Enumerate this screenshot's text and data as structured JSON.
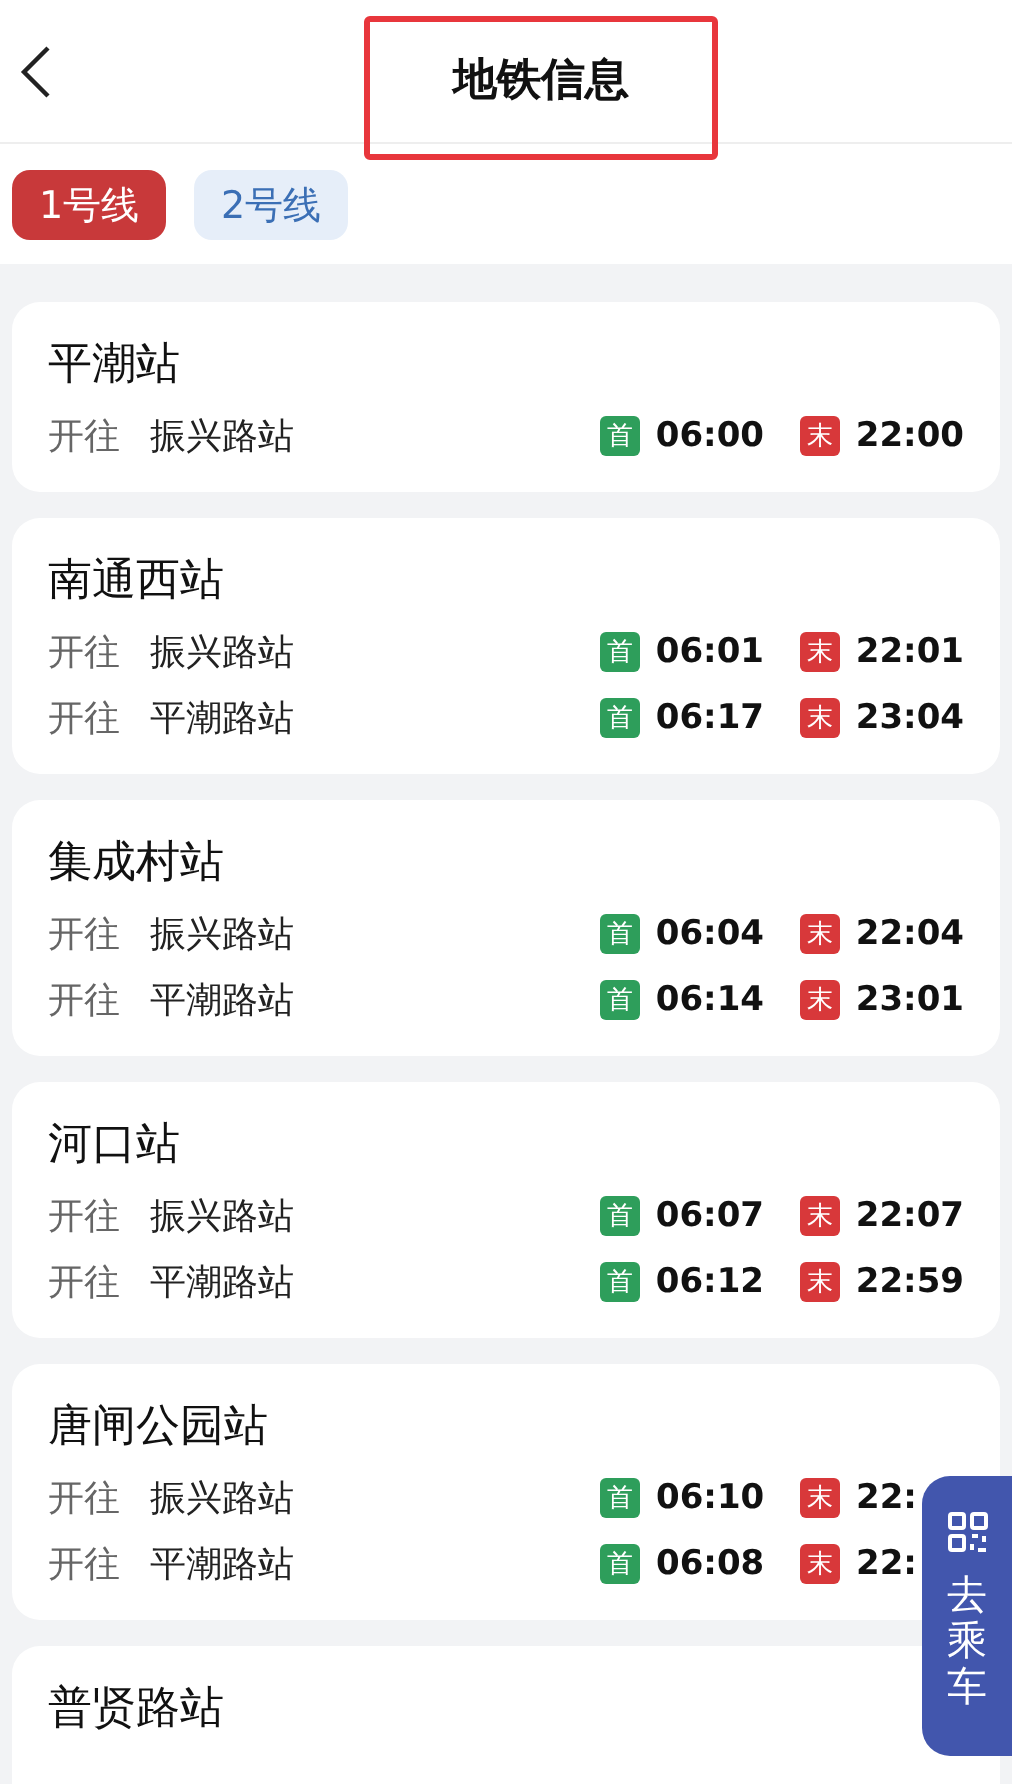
{
  "header": {
    "title": "地铁信息",
    "title_highlighted": true
  },
  "line_tabs": [
    {
      "label": "1号线",
      "selected": true
    },
    {
      "label": "2号线",
      "selected": false
    }
  ],
  "stations": [
    {
      "name": "平潮站",
      "trains": [
        {
          "toward_label": "开往",
          "destination": "振兴路站",
          "first_badge": "首",
          "first_time": "06:00",
          "last_badge": "末",
          "last_time": "22:00"
        }
      ]
    },
    {
      "name": "南通西站",
      "trains": [
        {
          "toward_label": "开往",
          "destination": "振兴路站",
          "first_badge": "首",
          "first_time": "06:01",
          "last_badge": "末",
          "last_time": "22:01"
        },
        {
          "toward_label": "开往",
          "destination": "平潮路站",
          "first_badge": "首",
          "first_time": "06:17",
          "last_badge": "末",
          "last_time": "23:04"
        }
      ]
    },
    {
      "name": "集成村站",
      "trains": [
        {
          "toward_label": "开往",
          "destination": "振兴路站",
          "first_badge": "首",
          "first_time": "06:04",
          "last_badge": "末",
          "last_time": "22:04"
        },
        {
          "toward_label": "开往",
          "destination": "平潮路站",
          "first_badge": "首",
          "first_time": "06:14",
          "last_badge": "末",
          "last_time": "23:01"
        }
      ]
    },
    {
      "name": "河口站",
      "trains": [
        {
          "toward_label": "开往",
          "destination": "振兴路站",
          "first_badge": "首",
          "first_time": "06:07",
          "last_badge": "末",
          "last_time": "22:07"
        },
        {
          "toward_label": "开往",
          "destination": "平潮路站",
          "first_badge": "首",
          "first_time": "06:12",
          "last_badge": "末",
          "last_time": "22:59"
        }
      ]
    },
    {
      "name": "唐闸公园站",
      "trains": [
        {
          "toward_label": "开往",
          "destination": "振兴路站",
          "first_badge": "首",
          "first_time": "06:10",
          "last_badge": "末",
          "last_time": "22:"
        },
        {
          "toward_label": "开往",
          "destination": "平潮路站",
          "first_badge": "首",
          "first_time": "06:08",
          "last_badge": "末",
          "last_time": "22:"
        }
      ]
    },
    {
      "name": "普贤路站"
    }
  ],
  "ride_button": {
    "label": "去乘车"
  }
}
